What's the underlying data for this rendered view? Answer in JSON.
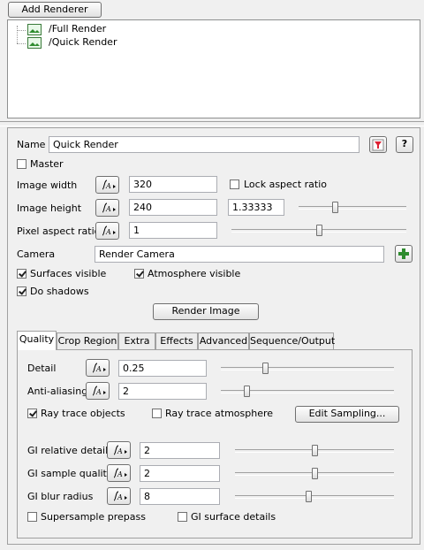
{
  "top": {
    "add_renderer_label": "Add Renderer"
  },
  "renderers": [
    {
      "label": "/Full Render",
      "icon": "image-icon"
    },
    {
      "label": "/Quick Render",
      "icon": "image-icon"
    }
  ],
  "props": {
    "name_label": "Name",
    "name_value": "Quick Render",
    "master_label": "Master",
    "image_width_label": "Image width",
    "image_width_value": "320",
    "lock_aspect_label": "Lock aspect ratio",
    "image_height_label": "Image height",
    "image_height_value": "240",
    "aspect_ratio_value": "1.33333",
    "pixel_aspect_label": "Pixel aspect ratio",
    "pixel_aspect_value": "1",
    "camera_label": "Camera",
    "camera_value": "Render Camera",
    "surfaces_visible_label": "Surfaces visible",
    "atmosphere_visible_label": "Atmosphere visible",
    "do_shadows_label": "Do shadows",
    "render_image_label": "Render Image",
    "help_label": "?"
  },
  "tabs": [
    {
      "label": "Quality"
    },
    {
      "label": "Crop Region"
    },
    {
      "label": "Extra"
    },
    {
      "label": "Effects"
    },
    {
      "label": "Advanced"
    },
    {
      "label": "Sequence/Output"
    }
  ],
  "quality": {
    "detail_label": "Detail",
    "detail_value": "0.25",
    "antialiasing_label": "Anti-aliasing",
    "antialiasing_value": "2",
    "ray_trace_objects_label": "Ray trace objects",
    "ray_trace_atmosphere_label": "Ray trace atmosphere",
    "edit_sampling_label": "Edit Sampling...",
    "gi_relative_detail_label": "GI relative detail",
    "gi_relative_detail_value": "2",
    "gi_sample_quality_label": "GI sample quality",
    "gi_sample_quality_value": "2",
    "gi_blur_radius_label": "GI blur radius",
    "gi_blur_radius_value": "8",
    "supersample_prepass_label": "Supersample prepass",
    "gi_surface_details_label": "GI surface details"
  },
  "colors": {
    "accent_green": "#2e8b2e",
    "panel_bg": "#f0f0f0"
  }
}
